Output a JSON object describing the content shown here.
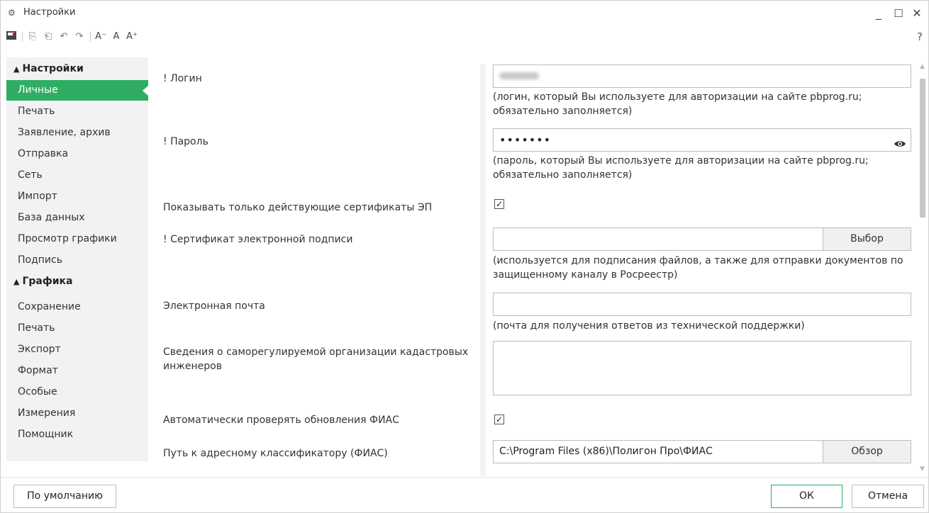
{
  "window": {
    "title": "Настройки",
    "minimize": "_",
    "maximize": "☐",
    "close": "✕"
  },
  "toolbar": {
    "help": "?"
  },
  "sidebar": {
    "section_settings": "Настройки",
    "settings_items": [
      "Личные",
      "Печать",
      "Заявление, архив",
      "Отправка",
      "Сеть",
      "Импорт",
      "База данных",
      "Просмотр графики",
      "Подпись"
    ],
    "section_graphics": "Графика",
    "graphics_items": [
      "Сохранение",
      "Печать",
      "Экспорт",
      "Формат",
      "Особые",
      "Измерения",
      "Помощник"
    ]
  },
  "form": {
    "login_label": "! Логин",
    "login_hint": "(логин, который Вы используете для авторизации на сайте pbprog.ru; обязательно заполняется)",
    "password_label": "! Пароль",
    "password_value": "•••••••",
    "password_hint": "(пароль, который Вы используете для авторизации на сайте pbprog.ru; обязательно заполняется)",
    "valid_certs_label": "Показывать только действующие сертификаты ЭП",
    "valid_certs_checked": "✓",
    "cert_label": "! Сертификат электронной подписи",
    "cert_button": "Выбор",
    "cert_hint": "(используется для подписания файлов, а также для отправки документов по защищенному каналу в Росреестр)",
    "email_label": "Электронная почта",
    "email_hint": "(почта для получения ответов из технической поддержки)",
    "sro_label": "Сведения о саморегулируемой организации кадастровых инженеров",
    "fias_update_label": "Автоматически проверять обновления ФИАС",
    "fias_update_checked": "✓",
    "fias_path_label": "Путь к адресному классификатору (ФИАС)",
    "fias_path_value": "C:\\Program Files (x86)\\Полигон Про\\ФИАС",
    "fias_browse_button": "Обзор"
  },
  "footer": {
    "default_button": "По умолчанию",
    "ok_button": "ОК",
    "cancel_button": "Отмена"
  },
  "colors": {
    "accent": "#2fae63"
  }
}
